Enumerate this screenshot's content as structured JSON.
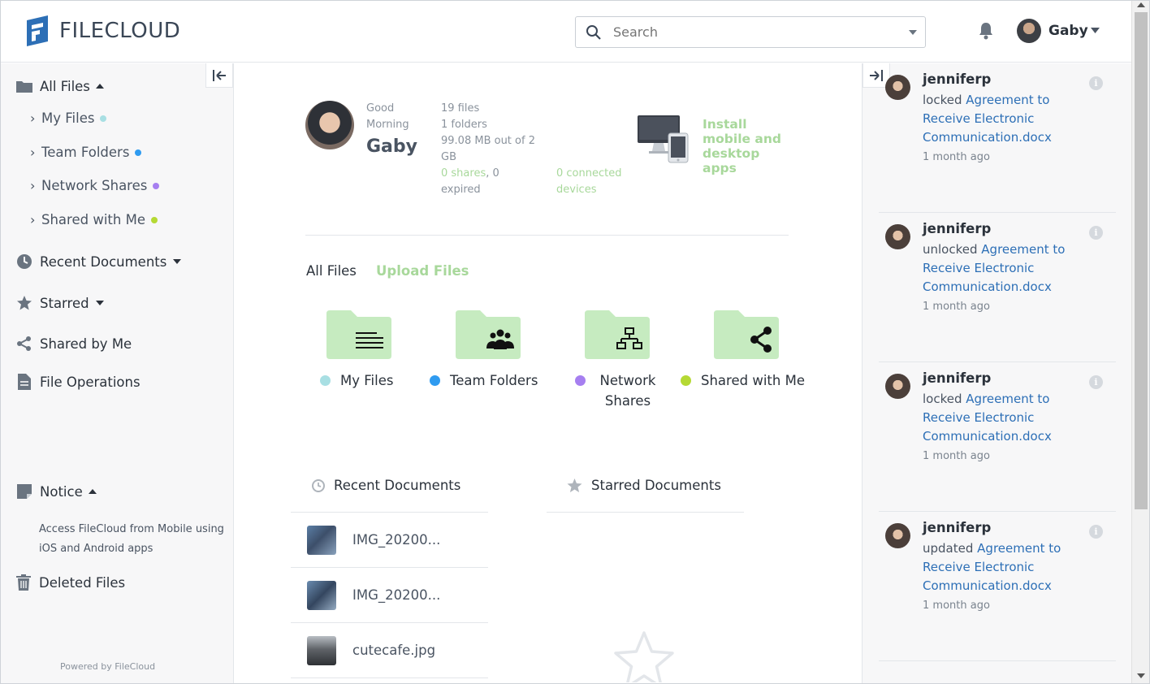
{
  "brand": {
    "name_light": "FILE",
    "name_bold": "CLOUD",
    "color": "#2d6fb6"
  },
  "search": {
    "placeholder": "Search"
  },
  "user": {
    "name": "Gaby"
  },
  "sidebar": {
    "all_files": "All Files",
    "sub_items": [
      {
        "label": "My Files",
        "color": "#a8dfe3"
      },
      {
        "label": "Team Folders",
        "color": "#2f9bf0"
      },
      {
        "label": "Network Shares",
        "color": "#a67ff0"
      },
      {
        "label": "Shared with Me",
        "color": "#b5d934"
      }
    ],
    "recent_documents": "Recent Documents",
    "starred": "Starred",
    "shared_by_me": "Shared by Me",
    "file_operations": "File Operations",
    "notice": "Notice",
    "notice_text": "Access FileCloud from Mobile using iOS and Android apps",
    "deleted_files": "Deleted Files",
    "powered_by": "Powered by FileCloud"
  },
  "greeting": {
    "label": "Good Morning",
    "name": "Gaby",
    "files": "19 files",
    "folders": "1 folders",
    "storage": "99.08 MB out of 2 GB",
    "shares": "0 shares",
    "expired": ", 0 expired",
    "devices": "0 connected devices",
    "install": "Install mobile and desktop apps"
  },
  "tabs": {
    "all_files": "All Files",
    "upload": "Upload Files"
  },
  "folders": [
    {
      "label": "My Files",
      "color": "#a8dfe3",
      "icon": "lines-icon"
    },
    {
      "label": "Team Folders",
      "color": "#2f9bf0",
      "icon": "group-icon"
    },
    {
      "label": "Network Shares",
      "color": "#a67ff0",
      "icon": "network-icon"
    },
    {
      "label": "Shared with Me",
      "color": "#b5d934",
      "icon": "share-icon"
    }
  ],
  "recent": {
    "title": "Recent Documents",
    "items": [
      "IMG_20200...",
      "IMG_20200...",
      "cutecafe.jpg"
    ]
  },
  "starred": {
    "title": "Starred Documents"
  },
  "activity": [
    {
      "user": "jenniferp",
      "action": "locked",
      "file": "Agreement to Receive Electronic Communication.docx",
      "time": "1 month ago"
    },
    {
      "user": "jenniferp",
      "action": "unlocked",
      "file": "Agreement to Receive Electronic Communication.docx",
      "time": "1 month ago"
    },
    {
      "user": "jenniferp",
      "action": "locked",
      "file": "Agreement to Receive Electronic Communication.docx",
      "time": "1 month ago"
    },
    {
      "user": "jenniferp",
      "action": "updated",
      "file": "Agreement to Receive Electronic Communication.docx",
      "time": "1 month ago"
    }
  ]
}
